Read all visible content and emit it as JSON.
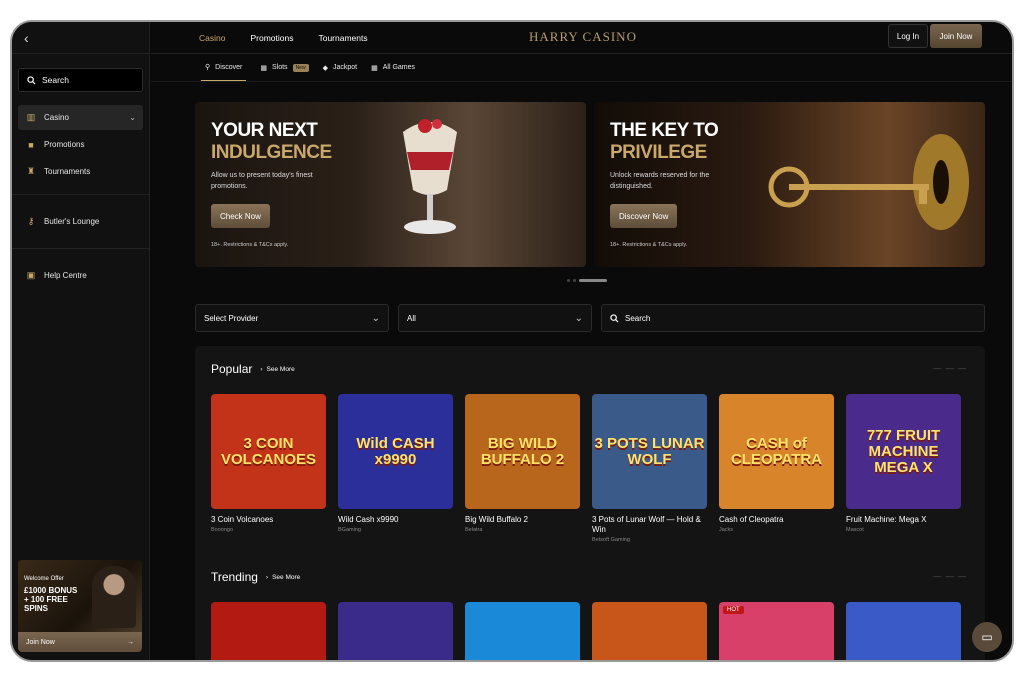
{
  "brand": {
    "logo": "HARRY CASINO",
    "accent": "#c9a86a"
  },
  "sidebar": {
    "search_label": "Search",
    "items": [
      {
        "label": "Casino",
        "icon": "casino-icon"
      },
      {
        "label": "Promotions",
        "icon": "gift-icon"
      },
      {
        "label": "Tournaments",
        "icon": "trophy-icon"
      }
    ],
    "lounge_label": "Butler's Lounge",
    "help_label": "Help Centre",
    "promo": {
      "small": "Welcome Offer",
      "big": "£1000 BONUS + 100 FREE SPINS"
    },
    "join_label": "Join Now"
  },
  "header": {
    "tabs": [
      "Casino",
      "Promotions",
      "Tournaments"
    ],
    "login_label": "Log In",
    "join_label": "Join Now"
  },
  "subtabs": [
    {
      "label": "Discover",
      "icon": "binoculars-icon"
    },
    {
      "label": "Slots",
      "icon": "slots-icon",
      "badge": "New"
    },
    {
      "label": "Jackpot",
      "icon": "diamond-icon"
    },
    {
      "label": "All Games",
      "icon": "grid-icon"
    }
  ],
  "banners": [
    {
      "line1": "YOUR NEXT",
      "line2": "INDULGENCE",
      "desc": "Allow us to present today's finest promotions.",
      "cta": "Check Now",
      "tc": "18+. Restrictions & T&Cs apply."
    },
    {
      "line1": "THE KEY TO",
      "line2": "PRIVILEGE",
      "desc": "Unlock rewards reserved for the distinguished.",
      "cta": "Discover Now",
      "tc": "18+. Restrictions & T&Cs apply."
    }
  ],
  "filters": {
    "provider": "Select Provider",
    "category": "All",
    "search": "Search"
  },
  "popular": {
    "title": "Popular",
    "see_more": "See More",
    "games": [
      {
        "name": "3 Coin Volcanoes",
        "provider": "Booongo",
        "art": "3 COIN VOLCANOES",
        "bg": "#c2331a"
      },
      {
        "name": "Wild Cash x9990",
        "provider": "BGaming",
        "art": "Wild CASH x9990",
        "bg": "#2a2f9a"
      },
      {
        "name": "Big Wild Buffalo 2",
        "provider": "Belatra",
        "art": "BIG WILD BUFFALO 2",
        "bg": "#b8661c"
      },
      {
        "name": "3 Pots of Lunar Wolf — Hold & Win",
        "provider": "Betsoft Gaming",
        "art": "3 POTS LUNAR WOLF",
        "bg": "#3a5a8a"
      },
      {
        "name": "Cash of Cleopatra",
        "provider": "Jacks",
        "art": "CASH of CLEOPATRA",
        "bg": "#d8842a"
      },
      {
        "name": "Fruit Machine: Mega X",
        "provider": "Mascot",
        "art": "777 FRUIT MACHINE MEGA X",
        "bg": "#4a2a8a"
      }
    ]
  },
  "trending": {
    "title": "Trending",
    "see_more": "See More",
    "games": [
      {
        "bg": "#b21a12",
        "badge": ""
      },
      {
        "bg": "#3a2a8a",
        "badge": ""
      },
      {
        "bg": "#1a8ad8",
        "badge": ""
      },
      {
        "bg": "#c8561a",
        "badge": ""
      },
      {
        "bg": "#d8406a",
        "badge": "HOT"
      },
      {
        "bg": "#3a5ac8",
        "badge": ""
      }
    ]
  }
}
